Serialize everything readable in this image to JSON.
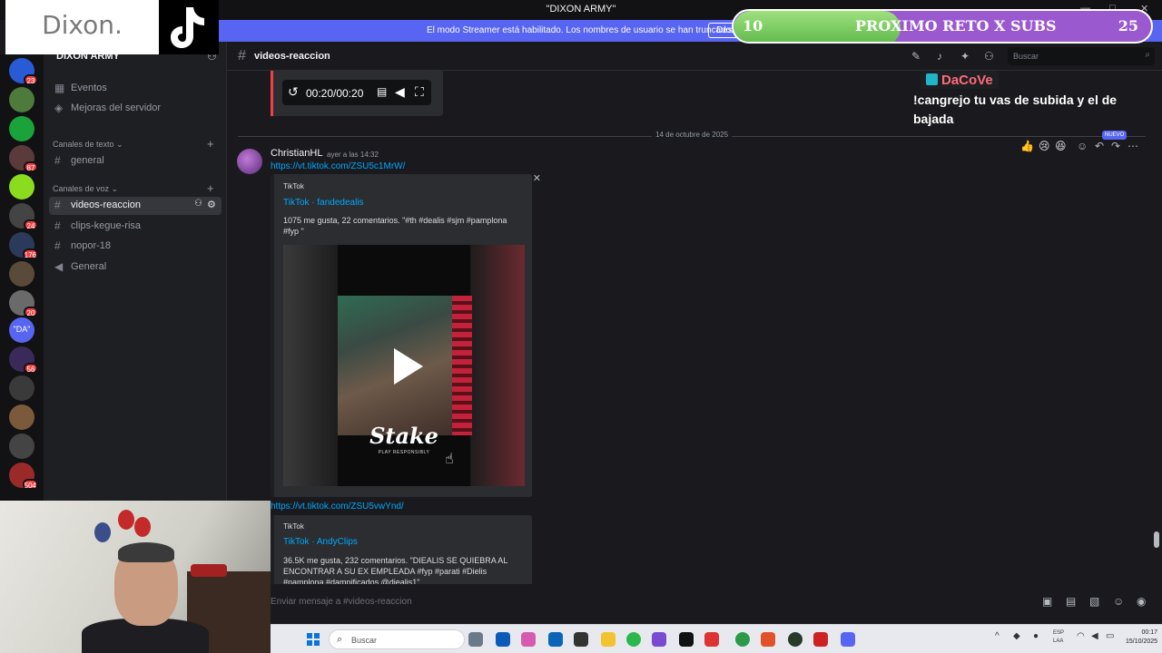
{
  "window": {
    "title": "\"DIXON ARMY\"",
    "title_icon": "discord-server-icon",
    "controls": [
      "—",
      "□",
      "✕"
    ]
  },
  "banner": {
    "text": "El modo Streamer está habilitado. Los nombres de usuario se han truncado.",
    "button_label": "Desh"
  },
  "overlay": {
    "dixon_logo_text": "Dixon.",
    "reto": {
      "current": "10",
      "label": "PROXIMO RETO X SUBS",
      "goal": "25",
      "progress_fraction": 0.4
    },
    "chat_user": "DaCoVe",
    "chat_message": "!cangrejo tu vas de subida y el de bajada"
  },
  "rail": {
    "servers": [
      {
        "name": "server-1",
        "badge": "23",
        "color": "#2a5bd7"
      },
      {
        "name": "server-2",
        "badge": "",
        "color": "#4e7a3b"
      },
      {
        "name": "server-3",
        "badge": "",
        "color": "#1aa33a"
      },
      {
        "name": "server-4",
        "badge": "87",
        "color": "#5a3a3a"
      },
      {
        "name": "server-5",
        "badge": "",
        "color": "#8bdc1e"
      },
      {
        "name": "server-6",
        "badge": "24",
        "color": "#444"
      },
      {
        "name": "server-7",
        "badge": "176",
        "color": "#2b3a5a"
      },
      {
        "name": "server-8",
        "badge": "",
        "color": "#5a4a3a"
      },
      {
        "name": "server-9",
        "badge": "20",
        "color": "#6a6a6a"
      },
      {
        "name": "server-10",
        "badge": "",
        "color": "#5865f2",
        "text": "\"DA\""
      },
      {
        "name": "server-11",
        "badge": "56",
        "color": "#3a2a5a"
      },
      {
        "name": "server-12",
        "badge": "",
        "color": "#3a3a3a"
      },
      {
        "name": "server-13",
        "badge": "",
        "color": "#7a5a3a"
      },
      {
        "name": "server-14",
        "badge": "",
        "color": "#444"
      },
      {
        "name": "server-15",
        "badge": "504",
        "color": "#9a2a2a"
      }
    ]
  },
  "sidebar": {
    "server_name": "DIXON ARMY",
    "items_top": [
      {
        "icon": "calendar-icon",
        "label": "Eventos"
      },
      {
        "icon": "boost-icon",
        "label": "Mejoras del servidor"
      }
    ],
    "text_category": "Canales de texto",
    "text_channels": [
      {
        "label": "general"
      }
    ],
    "voice_category": "Canales de voz",
    "voice_channels": [
      {
        "icon": "#",
        "label": "videos-reaccion",
        "active": true
      },
      {
        "icon": "#",
        "label": "clips-kegue-risa"
      },
      {
        "icon": "#",
        "label": "nopor-18"
      },
      {
        "icon": "🔊",
        "label": "General"
      }
    ]
  },
  "header": {
    "channel": "videos-reaccion",
    "search_placeholder": "Buscar"
  },
  "chat": {
    "audio_time": "00:20/00:20",
    "date_divider": "14 de octubre de 2025",
    "message": {
      "author": "ChristianHL",
      "time": "ayer a las 14:32",
      "link1": "https://vt.tiktok.com/ZSU5c1MrW/",
      "embed1": {
        "provider": "TikTok",
        "title": "TikTok · fandedealis",
        "description": "1075 me gusta, 22 comentarios. \"#th #dealis #sjm #pamplona #fyp \"",
        "video_brand": "Stake",
        "video_sub": "PLAY RESPONSIBLY"
      },
      "link2": "https://vt.tiktok.com/ZSU5vwYnd/",
      "embed2": {
        "provider": "TikTok",
        "title": "TikTok · AndyClips",
        "description": "36.5K me gusta, 232 comentarios. \"DIEALIS SE QUIEBRA AL ENCONTRAR A SU EX EMPLEADA #fyp #parati #Dielis #pamplona #damnificados @diealis1\""
      }
    },
    "new_badge": "NUEVO",
    "composer_placeholder": "Enviar mensaje a #videos-reaccion"
  },
  "taskbar": {
    "search_placeholder": "Buscar",
    "lang_top": "ESP",
    "lang_bottom": "LAA",
    "time": "00:17",
    "date": "15/10/2025"
  }
}
